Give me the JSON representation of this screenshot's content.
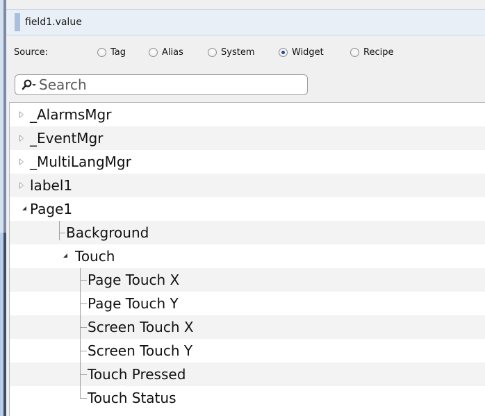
{
  "window": {
    "title": "field1.value"
  },
  "source": {
    "label": "Source:",
    "options": [
      {
        "label": "Tag",
        "selected": false
      },
      {
        "label": "Alias",
        "selected": false
      },
      {
        "label": "System",
        "selected": false
      },
      {
        "label": "Widget",
        "selected": true
      },
      {
        "label": "Recipe",
        "selected": false
      }
    ]
  },
  "search": {
    "placeholder": "Search",
    "value": ""
  },
  "tree": {
    "items": [
      {
        "label": "_AlarmsMgr",
        "level": 0,
        "expandable": true,
        "expanded": false
      },
      {
        "label": "_EventMgr",
        "level": 0,
        "expandable": true,
        "expanded": false
      },
      {
        "label": "_MultiLangMgr",
        "level": 0,
        "expandable": true,
        "expanded": false
      },
      {
        "label": "label1",
        "level": 0,
        "expandable": true,
        "expanded": false
      },
      {
        "label": "Page1",
        "level": 0,
        "expandable": true,
        "expanded": true
      },
      {
        "label": "Background",
        "level": 1,
        "expandable": false
      },
      {
        "label": "Touch",
        "level": 1,
        "expandable": true,
        "expanded": true
      },
      {
        "label": "Page Touch X",
        "level": 2,
        "expandable": false
      },
      {
        "label": "Page Touch Y",
        "level": 2,
        "expandable": false
      },
      {
        "label": "Screen Touch X",
        "level": 2,
        "expandable": false
      },
      {
        "label": "Screen Touch Y",
        "level": 2,
        "expandable": false
      },
      {
        "label": "Touch Pressed",
        "level": 2,
        "expandable": false
      },
      {
        "label": "Touch Status",
        "level": 2,
        "expandable": false
      }
    ]
  },
  "colors": {
    "accent": "#1c4e9b",
    "title_bar": "#e9eff6",
    "panel": "#f0f0f0",
    "alt_row": "#f3f3f3"
  }
}
